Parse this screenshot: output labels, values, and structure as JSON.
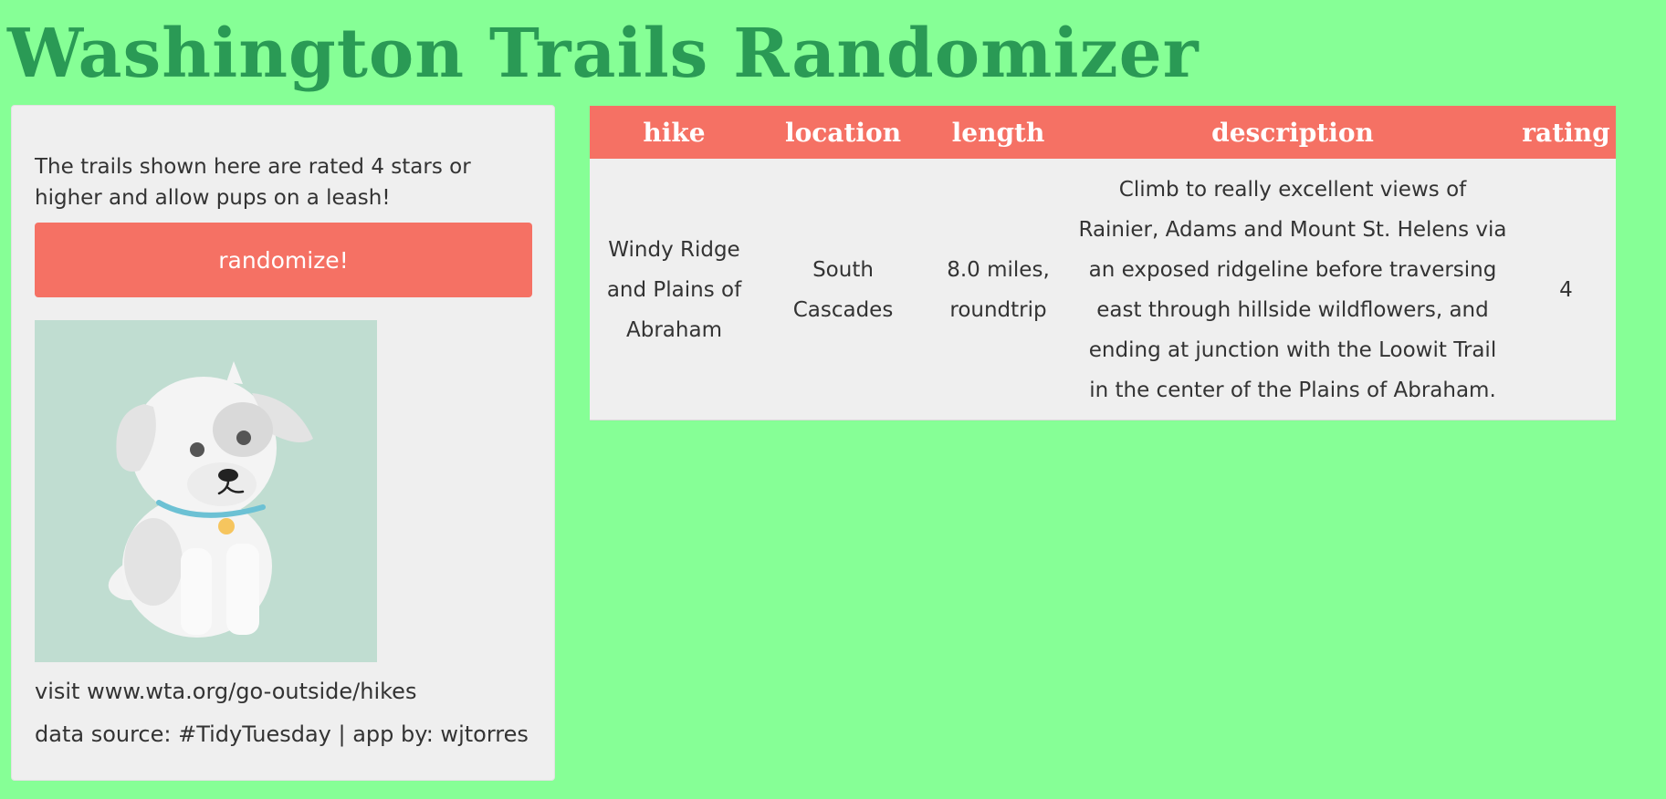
{
  "app": {
    "title": "Washington Trails Randomizer"
  },
  "sidebar": {
    "intro": "The trails shown here are rated 4 stars or higher and allow pups on a leash!",
    "button_label": "randomize!",
    "image_icon": "puppy-illustration",
    "visit_text": "visit www.wta.org/go-outside/hikes",
    "credit_text": "data source: #TidyTuesday | app by: wjtorres"
  },
  "table": {
    "columns": [
      "hike",
      "location",
      "length",
      "description",
      "rating"
    ],
    "rows": [
      {
        "hike": "Windy Ridge and Plains of Abraham",
        "location": "South Cascades",
        "length": "8.0 miles, roundtrip",
        "description": "Climb to really excellent views of Rainier, Adams and Mount St. Helens via an exposed ridgeline before traversing east through hillside wildflowers, and ending at junction with the Loowit Trail in the center of the Plains of Abraham.",
        "rating": "4"
      }
    ]
  },
  "colors": {
    "page_background": "#86ff96",
    "title": "#2a9a55",
    "accent": "#f57164",
    "panel": "#efefef",
    "image_background": "#c0ddd1"
  }
}
